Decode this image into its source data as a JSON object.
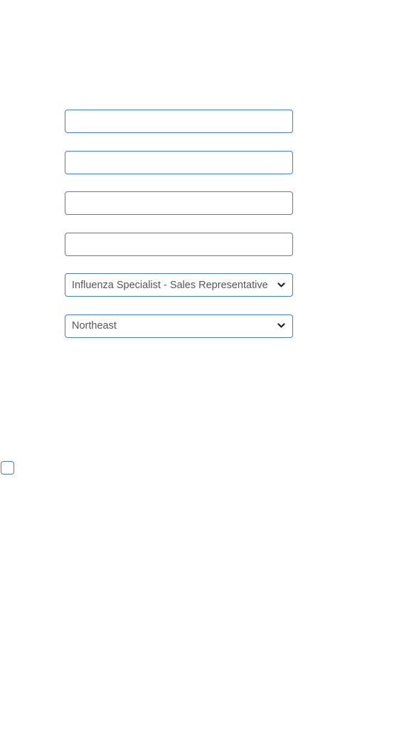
{
  "form": {
    "fields": [
      {
        "value": "",
        "placeholder": ""
      },
      {
        "value": "",
        "placeholder": ""
      },
      {
        "value": "",
        "placeholder": ""
      },
      {
        "value": "",
        "placeholder": ""
      }
    ],
    "role_select": {
      "selected": "Influenza Specialist - Sales Representative",
      "icon": "chevron-down-icon"
    },
    "region_select": {
      "selected": "Northeast",
      "icon": "chevron-down-icon"
    },
    "checkbox": {
      "checked": false
    }
  },
  "colors": {
    "border": "#4a7fb5",
    "text": "#555555",
    "background": "#ffffff"
  }
}
